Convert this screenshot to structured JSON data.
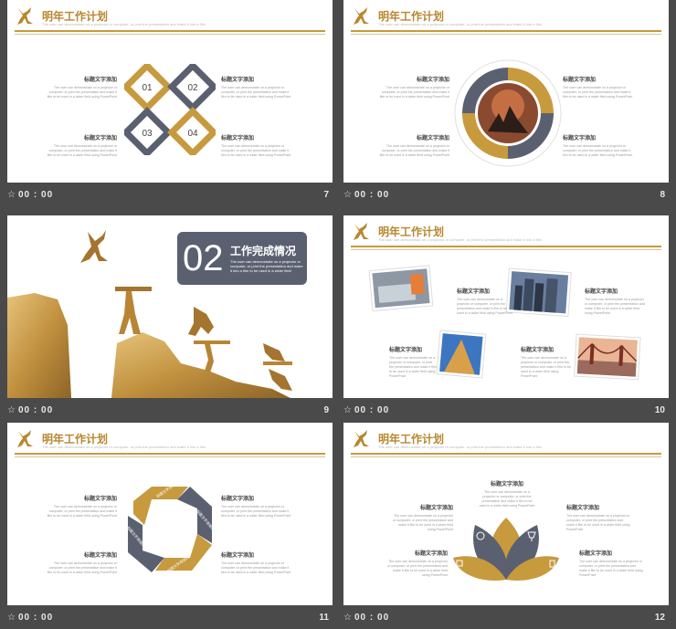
{
  "common": {
    "header_title": "明年工作计划",
    "header_sub": "The user can demonstrate on a projector or computer, or print the presentation and make it into a film",
    "block_title": "标题文字添加",
    "block_text": "The user can demonstrate on a projector or computer, or print the presentation and make it film to be used in a wider field using PowerPoint",
    "time": "00 : 00",
    "star": "☆"
  },
  "slides": [
    {
      "num": "7",
      "labels": [
        "01",
        "02",
        "03",
        "04"
      ]
    },
    {
      "num": "8"
    },
    {
      "num": "9",
      "big_num": "02",
      "section_title": "工作完成情况",
      "section_text": "The user can demonstrate on a projector or computer, or print the presentation and make it into a film to be used in a wider field"
    },
    {
      "num": "10"
    },
    {
      "num": "11",
      "arrow_labels": [
        "标题文字添加01",
        "标题文字添加02",
        "标题文字添加03",
        "标题文字添加04"
      ]
    },
    {
      "num": "12"
    }
  ],
  "colors": {
    "gold": "#c79a3e",
    "gray": "#5b6070",
    "bg": "#4a4a4a"
  }
}
